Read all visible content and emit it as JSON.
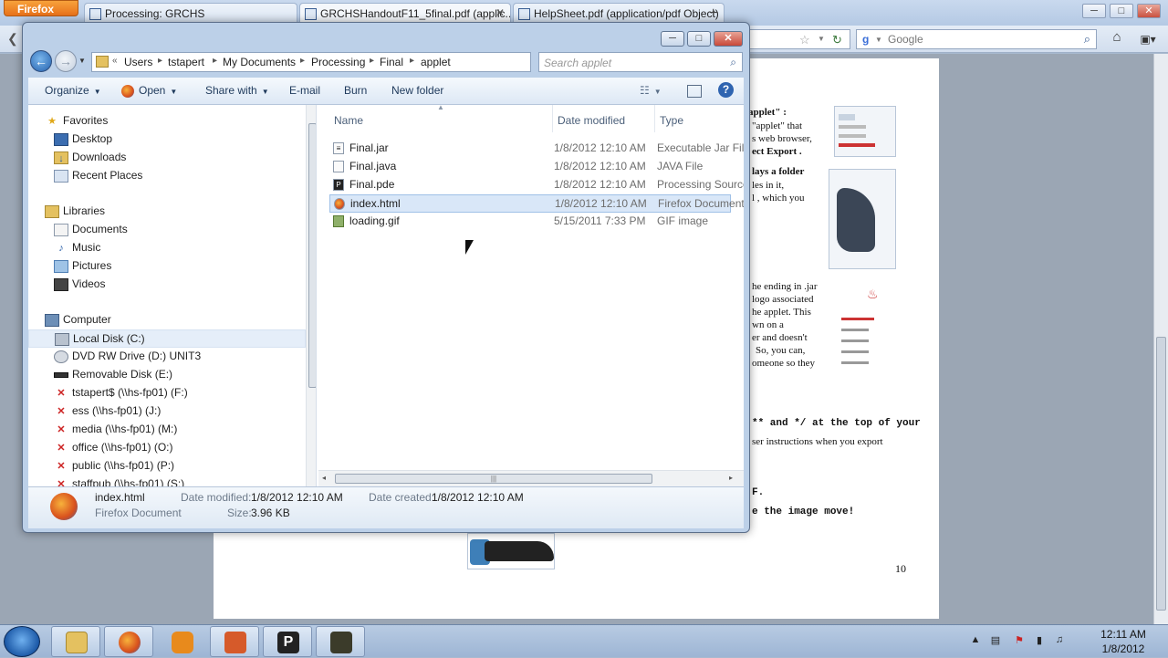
{
  "firefox": {
    "menu_button": "Firefox",
    "tabs": [
      {
        "label": "Processing: GRCHS"
      },
      {
        "label": "GRCHSHandoutF11_5final.pdf (applic..."
      },
      {
        "label": "HelpSheet.pdf (application/pdf Object)"
      }
    ],
    "new_tab": "+",
    "search_engine": "g",
    "search_placeholder": "Google",
    "window_controls": [
      "─",
      "□",
      "✕"
    ]
  },
  "pdf": {
    "page_number": "10",
    "lines": [
      {
        "text": "applet\" :"
      },
      {
        "text": "\"applet\" that"
      },
      {
        "text": "s web browser,"
      },
      {
        "text": "ect Export ."
      },
      {
        "text": "lays a folder"
      },
      {
        "text": "les in it,"
      },
      {
        "text": "l  , which you"
      },
      {
        "text": "he ending in .jar"
      },
      {
        "text": "logo associated"
      },
      {
        "text": "he applet.  This"
      },
      {
        "text": "wn on a"
      },
      {
        "text": "er and doesn't"
      },
      {
        "text": "So, you can,"
      },
      {
        "text": "omeone so they"
      },
      {
        "text": "ser instructions when you export"
      }
    ],
    "mono_lines": [
      {
        "text": "**  and */  at the top of your"
      },
      {
        "text": "F."
      },
      {
        "text": "e the image move!"
      }
    ]
  },
  "explorer": {
    "breadcrumb": [
      "Users",
      "tstapert",
      "My Documents",
      "Processing",
      "Final",
      "applet"
    ],
    "search_placeholder": "Search applet",
    "toolbar": {
      "organize": "Organize",
      "open": "Open",
      "share_with": "Share with",
      "email": "E-mail",
      "burn": "Burn",
      "new_folder": "New folder"
    },
    "nav": {
      "favorites": "Favorites",
      "favorites_items": [
        "Desktop",
        "Downloads",
        "Recent Places"
      ],
      "libraries": "Libraries",
      "libraries_items": [
        "Documents",
        "Music",
        "Pictures",
        "Videos"
      ],
      "computer": "Computer",
      "computer_items": [
        "Local Disk (C:)",
        "DVD RW Drive (D:) UNIT3",
        "Removable Disk (E:)",
        "tstapert$ (\\\\hs-fp01) (F:)",
        "ess (\\\\hs-fp01) (J:)",
        "media (\\\\hs-fp01) (M:)",
        "office (\\\\hs-fp01) (O:)",
        "public (\\\\hs-fp01) (P:)",
        "staffpub (\\\\hs-fp01) (S:)"
      ]
    },
    "columns": {
      "name": "Name",
      "date": "Date modified",
      "type": "Type"
    },
    "files": [
      {
        "name": "Final.jar",
        "date": "1/8/2012 12:10 AM",
        "type": "Executable Jar File",
        "icon": "jar-file-icon"
      },
      {
        "name": "Final.java",
        "date": "1/8/2012 12:10 AM",
        "type": "JAVA File",
        "icon": "java-file-icon"
      },
      {
        "name": "Final.pde",
        "date": "1/8/2012 12:10 AM",
        "type": "Processing Source",
        "icon": "pde-file-icon"
      },
      {
        "name": "index.html",
        "date": "1/8/2012 12:10 AM",
        "type": "Firefox Document",
        "icon": "html-file-icon"
      },
      {
        "name": "loading.gif",
        "date": "5/15/2011 7:33 PM",
        "type": "GIF image",
        "icon": "gif-file-icon"
      }
    ],
    "selected_file": "index.html",
    "details": {
      "name": "index.html",
      "kind": "Firefox Document",
      "modified_label": "Date modified:",
      "modified": "1/8/2012 12:10 AM",
      "created_label": "Date created:",
      "created": "1/8/2012 12:10 AM",
      "size_label": "Size:",
      "size": "3.96 KB"
    }
  },
  "taskbar": {
    "time": "12:11 AM",
    "date": "1/8/2012"
  }
}
